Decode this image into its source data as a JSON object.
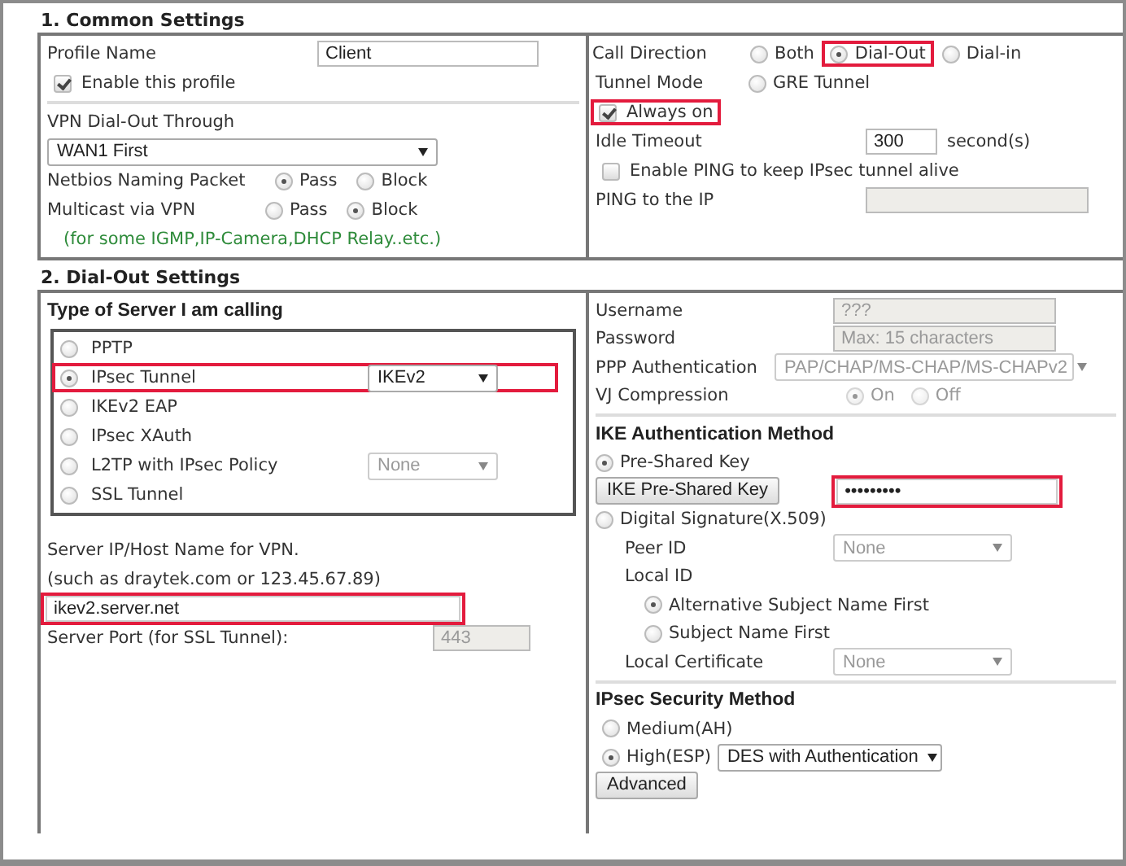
{
  "common_settings": {
    "title": "1. Common Settings",
    "profile_name": {
      "label": "Profile Name",
      "value": "Client"
    },
    "enable_profile": {
      "label": "Enable this profile",
      "checked": true
    },
    "dial_out_through": {
      "label": "VPN Dial-Out Through",
      "value": "WAN1 First"
    },
    "netbios": {
      "label": "Netbios Naming Packet",
      "options": [
        {
          "label": "Pass",
          "selected": true
        },
        {
          "label": "Block",
          "selected": false
        }
      ]
    },
    "multicast": {
      "label": "Multicast via VPN",
      "options": [
        {
          "label": "Pass",
          "selected": false
        },
        {
          "label": "Block",
          "selected": true
        }
      ]
    },
    "multicast_note": "(for some IGMP,IP-Camera,DHCP Relay..etc.)",
    "call_direction": {
      "label": "Call Direction",
      "options": [
        {
          "label": "Both",
          "selected": false,
          "highlighted": false
        },
        {
          "label": "Dial-Out",
          "selected": true,
          "highlighted": true
        },
        {
          "label": "Dial-in",
          "selected": false,
          "highlighted": false
        }
      ]
    },
    "tunnel_mode": {
      "label": "Tunnel Mode",
      "options": [
        {
          "label": "GRE Tunnel",
          "selected": false
        }
      ]
    },
    "always_on": {
      "label": "Always on",
      "checked": true,
      "highlighted": true
    },
    "idle_timeout": {
      "label": "Idle Timeout",
      "value": "300",
      "unit": "second(s)"
    },
    "ping_keepalive": {
      "label": "Enable PING to keep IPsec tunnel alive",
      "checked": false
    },
    "ping_ip": {
      "label": "PING to the IP",
      "disabled": true
    }
  },
  "dial_out_settings": {
    "title": "2. Dial-Out Settings",
    "server_type": {
      "heading": "Type of Server I am calling",
      "options": [
        {
          "label": "PPTP",
          "selected": false,
          "highlighted": false
        },
        {
          "label": "IPsec Tunnel",
          "selected": true,
          "highlighted": true,
          "select": {
            "value": "IKEv2",
            "disabled": false
          }
        },
        {
          "label": "IKEv2 EAP",
          "selected": false,
          "highlighted": false
        },
        {
          "label": "IPsec XAuth",
          "selected": false,
          "highlighted": false
        },
        {
          "label": "L2TP with IPsec Policy",
          "selected": false,
          "highlighted": false,
          "select": {
            "value": "None",
            "disabled": true
          }
        },
        {
          "label": "SSL Tunnel",
          "selected": false,
          "highlighted": false
        }
      ]
    },
    "server_host": {
      "label": "Server IP/Host Name for VPN.",
      "hint": "(such as draytek.com or 123.45.67.89)",
      "value": "ikev2.server.net",
      "highlighted": true
    },
    "server_port": {
      "label": "Server Port (for SSL Tunnel):",
      "value": "443",
      "disabled": true
    },
    "username": {
      "label": "Username",
      "value": "???",
      "disabled": true
    },
    "password": {
      "label": "Password",
      "value": "Max: 15 characters",
      "disabled": true
    },
    "ppp_auth": {
      "label": "PPP Authentication",
      "value": "PAP/CHAP/MS-CHAP/MS-CHAPv2",
      "disabled": true
    },
    "vj_compression": {
      "label": "VJ Compression",
      "disabled": true,
      "options": [
        {
          "label": "On",
          "selected": true
        },
        {
          "label": "Off",
          "selected": false
        }
      ]
    },
    "ike_auth": {
      "heading": "IKE Authentication Method",
      "pre_shared": {
        "label": "Pre-Shared Key",
        "selected": true
      },
      "key_button": "IKE Pre-Shared Key",
      "key_value": "•••••••••",
      "key_highlighted": true,
      "digital_signature": {
        "label": "Digital Signature(X.509)",
        "selected": false
      },
      "peer_id": {
        "label": "Peer ID",
        "value": "None",
        "disabled": true
      },
      "local_id": "Local ID",
      "local_id_options": [
        {
          "label": "Alternative Subject Name First",
          "selected": true
        },
        {
          "label": "Subject Name First",
          "selected": false
        }
      ],
      "local_certificate": {
        "label": "Local Certificate",
        "value": "None",
        "disabled": true
      }
    },
    "ipsec_security": {
      "heading": "IPsec Security Method",
      "options": [
        {
          "label": "Medium(AH)",
          "selected": false
        },
        {
          "label": "High(ESP)",
          "selected": true,
          "select": {
            "value": "DES with Authentication",
            "disabled": false
          }
        }
      ],
      "advanced_button": "Advanced"
    }
  }
}
